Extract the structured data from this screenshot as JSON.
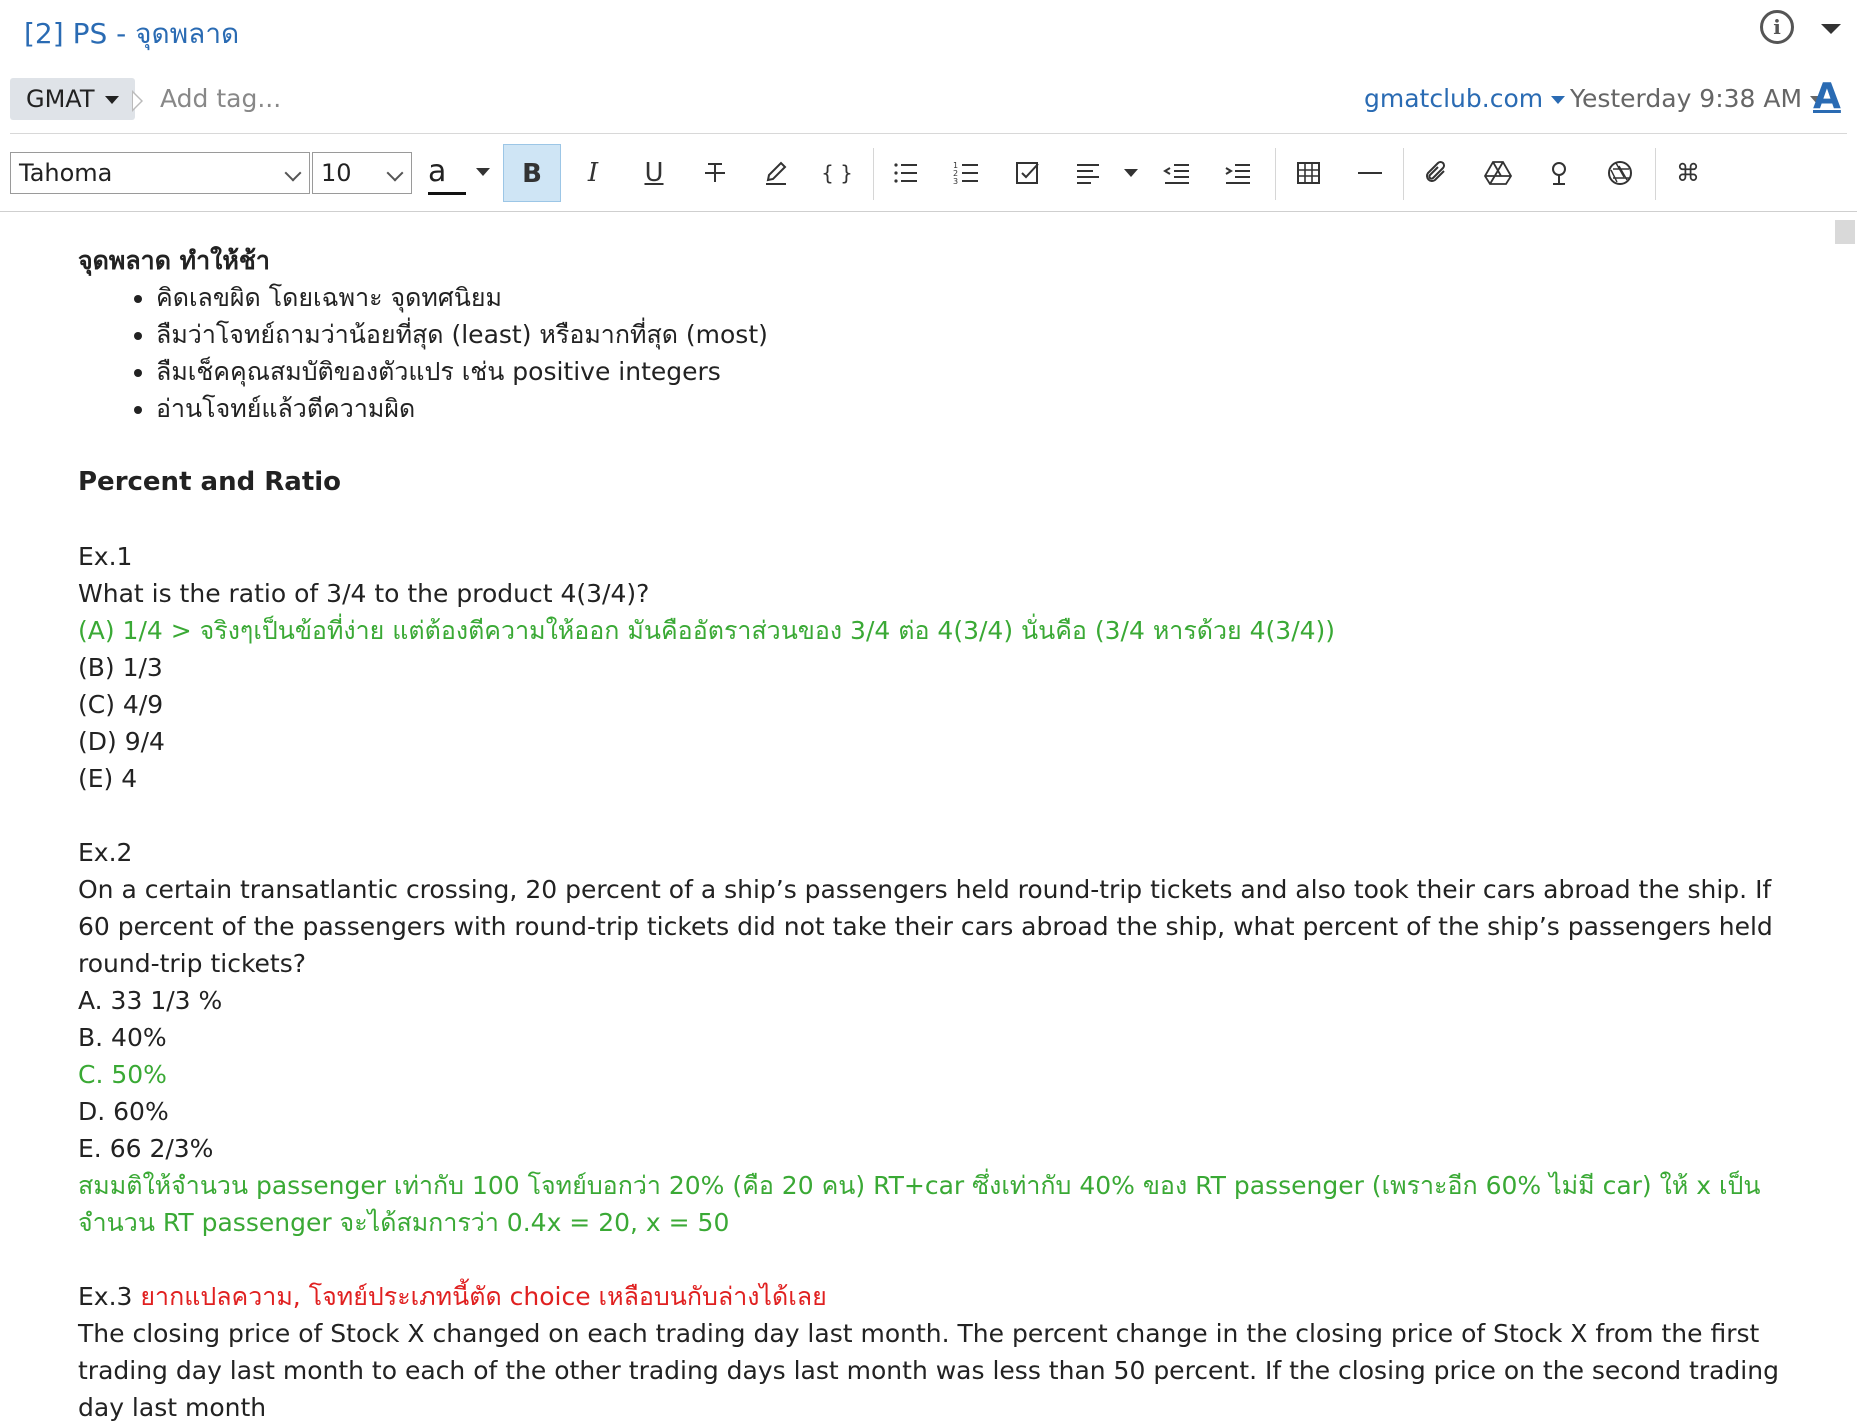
{
  "header": {
    "note_title": "[2] PS - จุดพลาด",
    "notebook": "GMAT",
    "add_tag_placeholder": "Add tag...",
    "source": "gmatclub.com",
    "timestamp": "Yesterday 9:38 AM",
    "font_icon_label": "A"
  },
  "toolbar": {
    "font_family": "Tahoma",
    "font_size": "10",
    "text_color_label": "a",
    "bold_label": "B",
    "italic_label": "I",
    "underline_label": "U",
    "code_label": "{ }",
    "command_label": "⌘"
  },
  "content": {
    "mistakes_heading": "จุดพลาด ทำให้ช้า",
    "mistakes": [
      "คิดเลขผิด โดยเฉพาะ จุดทศนิยม",
      "ลืมว่าโจทย์ถามว่าน้อยที่สุด (least) หรือมากที่สุด (most)",
      "ลืมเช็คคุณสมบัติของตัวแปร เช่น positive integers",
      "อ่านโจทย์แล้วตีความผิด"
    ],
    "section_title": "Percent and Ratio",
    "ex1": {
      "label": "Ex.1",
      "question": "What is the ratio of 3/4 to the product 4(3/4)?",
      "choice_a": "(A) 1/4 > จริงๆเป็นข้อที่ง่าย แต่ต้องตีความให้ออก มันคืออัตราส่วนของ 3/4 ต่อ 4(3/4) นั่นคือ (3/4 หารด้วย 4(3/4))",
      "choices": [
        "(B) 1/3",
        "(C) 4/9",
        "(D) 9/4",
        "(E) 4"
      ]
    },
    "ex2": {
      "label": "Ex.2",
      "question": "On a certain transatlantic crossing, 20 percent of a ship’s passengers held round-trip tickets and also took their cars abroad the ship. If 60 percent of the passengers with round-trip tickets did not take their cars abroad the ship, what percent of the ship’s passengers held round-trip tickets?",
      "choice_a": "A. 33 1/3 %",
      "choice_b": "B. 40%",
      "choice_c": "C. 50%",
      "choice_d": "D. 60%",
      "choice_e": "E. 66 2/3%",
      "explanation": "สมมติให้จำนวน passenger เท่ากับ 100 โจทย์บอกว่า 20% (คือ 20 คน) RT+car ซึ่งเท่ากับ 40% ของ RT passenger (เพราะอีก 60% ไม่มี car) ให้ x เป็นจำนวน RT passenger จะได้สมการว่า 0.4x = 20, x = 50"
    },
    "ex3": {
      "label": "Ex.3",
      "note": "ยากแปลความ, โจทย์ประเภทนี้ตัด choice เหลือบนกับล่างได้เลย",
      "question": "The closing price of Stock X changed on each trading day last month. The percent change in the closing price of Stock X from the first trading day last month to each of the other trading days last month was less than 50 percent. If the closing price on the second trading day last month"
    }
  },
  "colors": {
    "link": "#2a6bb3",
    "answer_green": "#3aa935",
    "note_red": "#e02020",
    "active_button": "#cfe5f5"
  }
}
